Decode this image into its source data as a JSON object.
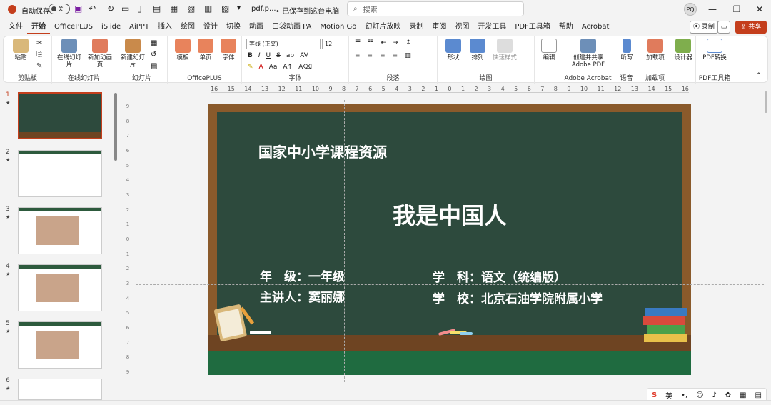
{
  "titlebar": {
    "autosave_label": "自动保存",
    "autosave_state": "关",
    "filename": "pdf.p...",
    "save_status": "• 已保存到这台电脑",
    "search_placeholder": "搜索",
    "avatar_initials": "PQ"
  },
  "menu": {
    "tabs": [
      "文件",
      "开始",
      "OfficePLUS",
      "iSlide",
      "AiPPT",
      "插入",
      "绘图",
      "设计",
      "切换",
      "动画",
      "口袋动画 PA",
      "Motion Go",
      "幻灯片放映",
      "录制",
      "审阅",
      "视图",
      "开发工具",
      "PDF工具箱",
      "帮助",
      "Acrobat"
    ],
    "active_tab": "开始",
    "record_label": "录制",
    "share_label": "共享"
  },
  "ribbon": {
    "clipboard": {
      "label": "剪贴板",
      "paste": "粘贴"
    },
    "online_slides": {
      "label": "在线幻灯片",
      "online": "在线幻灯片",
      "new_anim": "新加动画页"
    },
    "slides": {
      "label": "幻灯片",
      "new_slide": "新建幻灯片"
    },
    "officeplus": {
      "label": "OfficePLUS",
      "template": "模板",
      "single": "单页",
      "font": "字体"
    },
    "font": {
      "label": "字体",
      "family": "等线 (正文)",
      "size": "12"
    },
    "paragraph": {
      "label": "段落"
    },
    "drawing": {
      "label": "绘图",
      "shape": "形状",
      "arrange": "排列",
      "quick_style": "快速样式"
    },
    "editing": {
      "edit": "编辑"
    },
    "adobe": {
      "label": "Adobe Acrobat",
      "create": "创建并共享 Adobe PDF"
    },
    "voice": {
      "label": "语音",
      "dictate": "听写"
    },
    "addins": {
      "label": "加载项",
      "addin": "加载项"
    },
    "designer": {
      "label": "设计器"
    },
    "pdftools": {
      "label": "PDF工具箱",
      "convert": "PDF转换"
    }
  },
  "ruler": {
    "marks": [
      "16",
      "15",
      "14",
      "13",
      "12",
      "11",
      "10",
      "9",
      "8",
      "7",
      "6",
      "5",
      "4",
      "3",
      "2",
      "1",
      "0",
      "1",
      "2",
      "3",
      "4",
      "5",
      "6",
      "7",
      "8",
      "9",
      "10",
      "11",
      "12",
      "13",
      "14",
      "15",
      "16"
    ]
  },
  "thumbnails": [
    {
      "num": "1",
      "star": "★"
    },
    {
      "num": "2",
      "star": "★"
    },
    {
      "num": "3",
      "star": "★"
    },
    {
      "num": "4",
      "star": "★"
    },
    {
      "num": "5",
      "star": "★"
    },
    {
      "num": "6",
      "star": "★"
    }
  ],
  "slide": {
    "header": "国家中小学课程资源",
    "title": "我是中国人",
    "grade": "年　级：一年级",
    "subject": "学　科：语文（统编版）",
    "speaker": "主讲人：窦丽娜",
    "school": "学　校：北京石油学院附属小学"
  },
  "ime": {
    "lang": "英"
  }
}
